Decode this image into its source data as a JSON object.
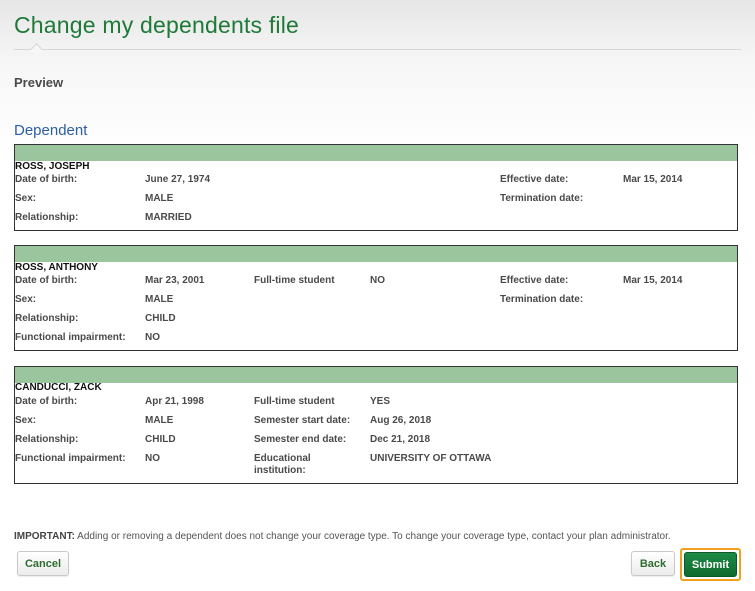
{
  "page": {
    "title": "Change my dependents file",
    "subtitle": "Preview",
    "section_heading": "Dependent"
  },
  "dependents": [
    {
      "name": "ROSS, JOSEPH",
      "dob_label": "Date of birth:",
      "dob": "June 27, 1974",
      "sex_label": "Sex:",
      "sex": "MALE",
      "relationship_label": "Relationship:",
      "relationship": "MARRIED",
      "effective_label": "Effective date:",
      "effective": "Mar 15, 2014",
      "termination_label": "Termination date:",
      "termination": ""
    },
    {
      "name": "ROSS, ANTHONY",
      "dob_label": "Date of birth:",
      "dob": "Mar 23, 2001",
      "fulltime_label": "Full-time student",
      "fulltime": "NO",
      "sex_label": "Sex:",
      "sex": "MALE",
      "relationship_label": "Relationship:",
      "relationship": "CHILD",
      "impairment_label": "Functional impairment:",
      "impairment": "NO",
      "effective_label": "Effective date:",
      "effective": "Mar 15, 2014",
      "termination_label": "Termination date:",
      "termination": ""
    },
    {
      "name": "CANDUCCI, ZACK",
      "dob_label": "Date of birth:",
      "dob": "Apr 21, 1998",
      "fulltime_label": "Full-time student",
      "fulltime": "YES",
      "sex_label": "Sex:",
      "sex": "MALE",
      "semester_start_label": "Semester start date:",
      "semester_start": "Aug 26, 2018",
      "relationship_label": "Relationship:",
      "relationship": "CHILD",
      "semester_end_label": "Semester end date:",
      "semester_end": "Dec 21, 2018",
      "impairment_label": "Functional impairment:",
      "impairment": "NO",
      "institution_label_line1": "Educational",
      "institution_label_line2": "institution:",
      "institution": "UNIVERSITY OF OTTAWA"
    }
  ],
  "notice": {
    "prefix": "IMPORTANT:",
    "text": " Adding or removing a dependent does not change your coverage type. To change your coverage type, contact your plan administrator."
  },
  "buttons": {
    "cancel": "Cancel",
    "back": "Back",
    "submit": "Submit"
  },
  "colors": {
    "title": "#1f7a3a",
    "section_heading": "#2b5ea5",
    "header_bar": "#9bc59d",
    "submit_bg": "#1d8a45",
    "submit_focus_ring": "#f0a020"
  }
}
